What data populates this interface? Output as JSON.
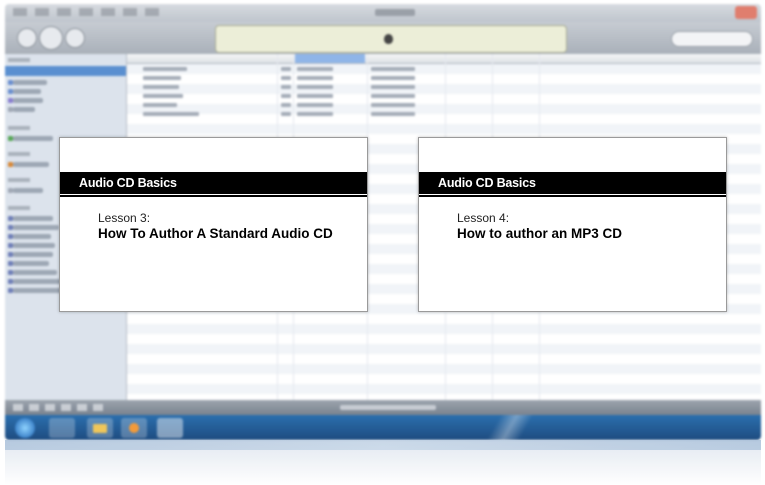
{
  "background_app": {
    "description_visible": false,
    "sidebar_item_count": 24,
    "list_row_count": 6
  },
  "cards": [
    {
      "header": "Audio CD Basics",
      "lesson": "Lesson 3:",
      "title": "How To Author A Standard Audio CD"
    },
    {
      "header": "Audio CD Basics",
      "lesson": "Lesson 4:",
      "title": "How to author an MP3 CD"
    }
  ],
  "colors": {
    "header_bar": "#000000",
    "card_bg": "#ffffff",
    "taskbar": "#2b6fae"
  }
}
